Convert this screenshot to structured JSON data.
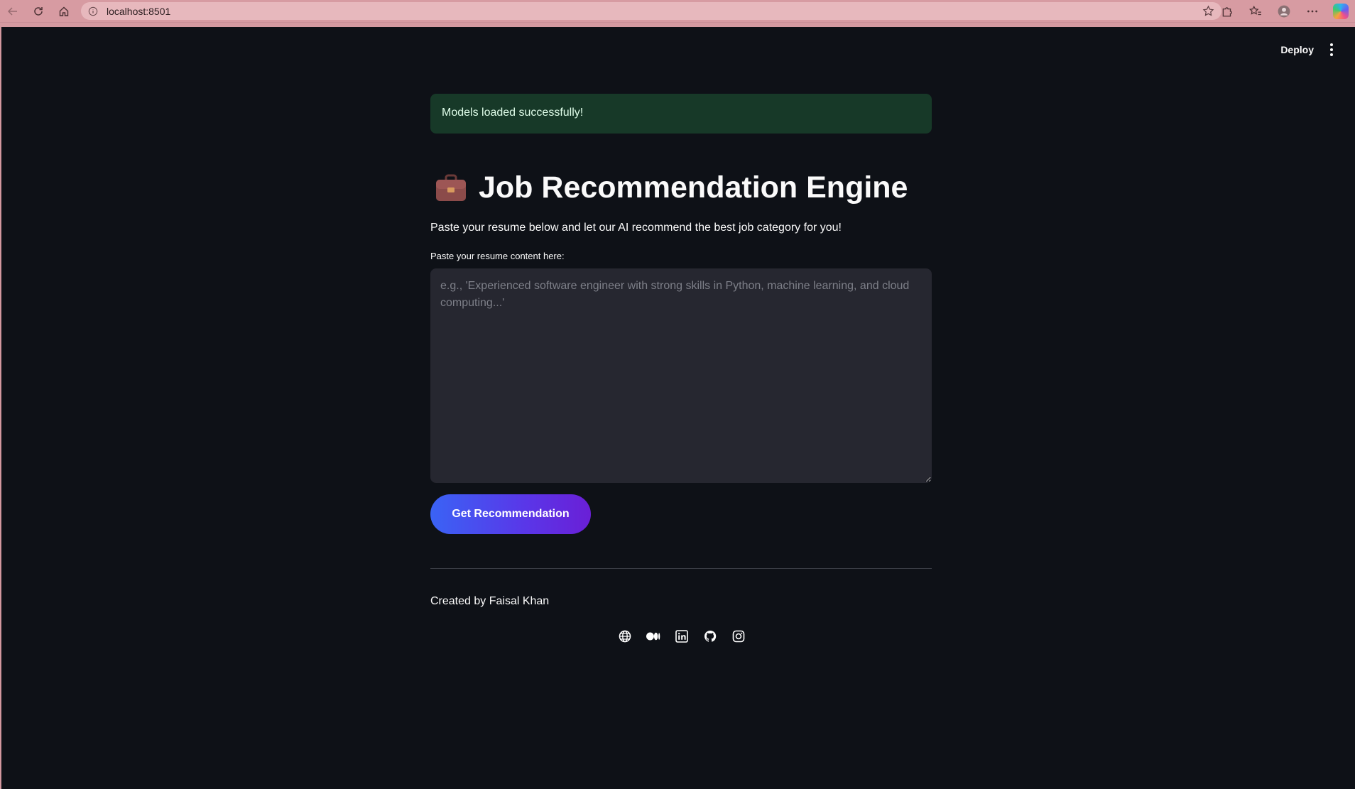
{
  "browser": {
    "url": "localhost:8501"
  },
  "toolbar": {
    "deploy_label": "Deploy"
  },
  "alert": {
    "message": "Models loaded successfully!"
  },
  "header": {
    "icon": "briefcase-icon",
    "title": "Job Recommendation Engine",
    "subtitle": "Paste your resume below and let our AI recommend the best job category for you!"
  },
  "form": {
    "label": "Paste your resume content here:",
    "value": "",
    "placeholder": "e.g., 'Experienced software engineer with strong skills in Python, machine learning, and cloud computing...'",
    "button_label": "Get Recommendation"
  },
  "footer": {
    "credit": "Created by Faisal Khan",
    "social_icons": [
      "globe-icon",
      "medium-icon",
      "linkedin-icon",
      "github-icon",
      "instagram-icon"
    ]
  },
  "colors": {
    "background": "#0e1117",
    "success_bg": "#173928",
    "input_bg": "#262730",
    "button_gradient_start": "#3a63f5",
    "button_gradient_end": "#6a1fd6",
    "browser_chrome": "#d79ba2"
  }
}
